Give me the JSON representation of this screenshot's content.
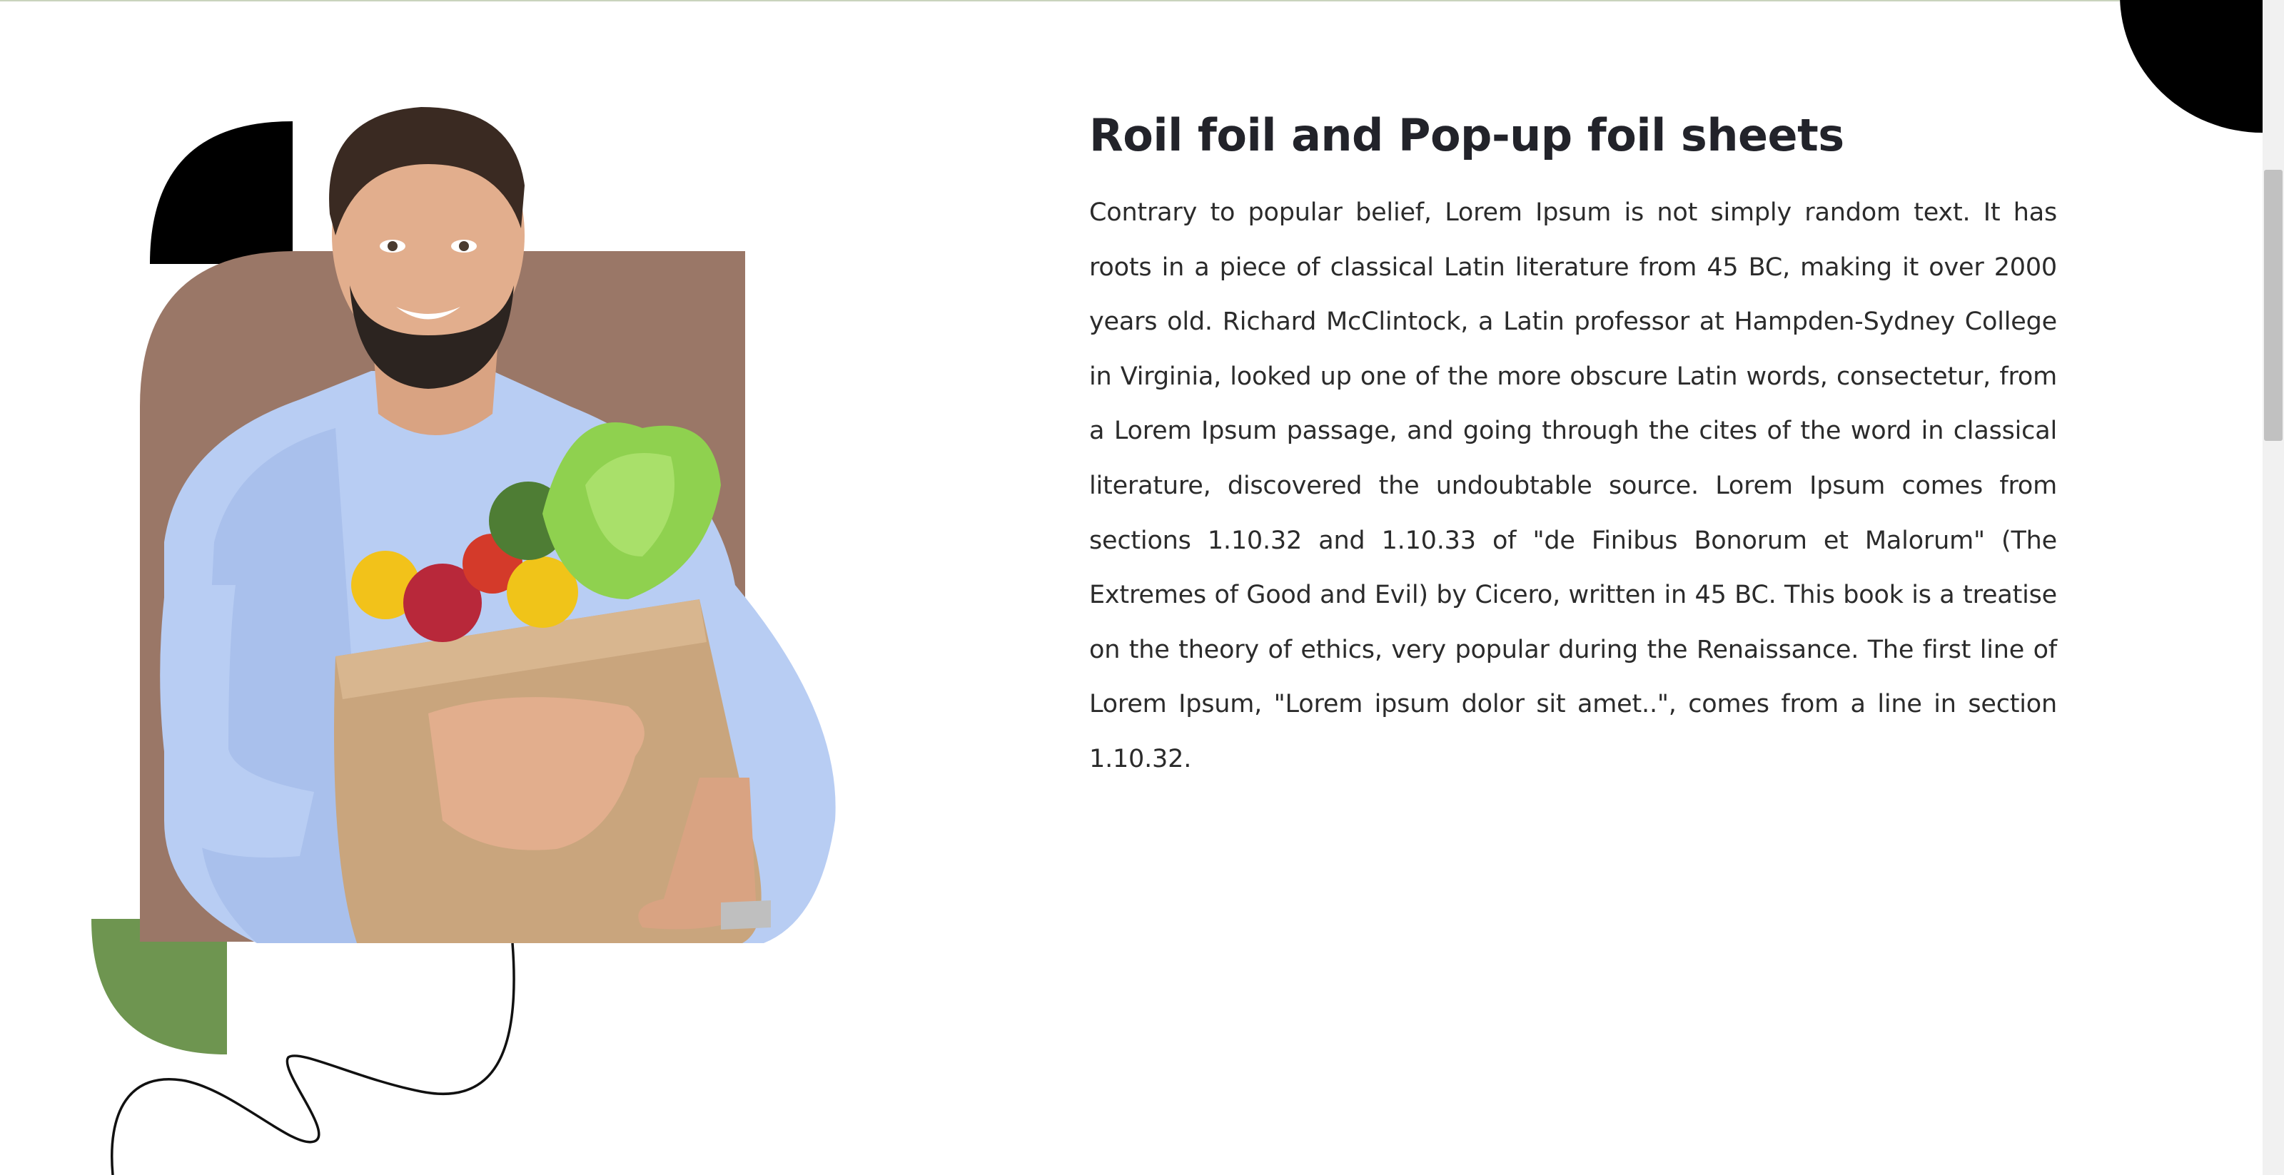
{
  "section": {
    "title": "Roil foil and Pop-up foil sheets",
    "paragraph": "Contrary to popular belief, Lorem Ipsum is not simply random text. It has roots in a piece of classical Latin literature from 45 BC, making it over 2000 years old. Richard McClintock, a Latin professor at Hampden-Sydney College in Virginia, looked up one of the more obscure Latin words, consectetur, from a Lorem Ipsum passage, and going through the cites of the word in classical literature, discovered the undoubtable source. Lorem Ipsum comes from sections 1.10.32 and 1.10.33 of \"de Finibus Bonorum et Malorum\" (The Extremes of Good and Evil) by Cicero, written in 45 BC. This book is a treatise on the theory of ethics, very popular during the Renaissance. The first line of Lorem Ipsum, \"Lorem ipsum dolor sit amet..\", comes from a line in section 1.10.32."
  },
  "colors": {
    "heading": "#22232a",
    "body": "#2b2b2b",
    "brown_block": "#9a7767",
    "black_shape": "#000000",
    "green_shape": "#6e9550",
    "background": "#ffffff"
  },
  "images": {
    "hero": "man-holding-grocery-bag-photo"
  }
}
